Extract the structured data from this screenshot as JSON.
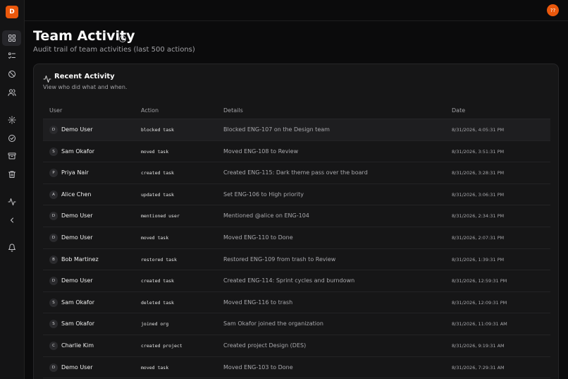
{
  "app": {
    "logo_letter": "D",
    "user_initials": "??"
  },
  "sidebar": {
    "items": [
      {
        "icon": "dashboard-icon",
        "active": true
      },
      {
        "icon": "list-checks-icon",
        "active": false
      },
      {
        "icon": "ban-icon",
        "active": false
      },
      {
        "icon": "users-icon",
        "active": false
      },
      {
        "icon": "gear-icon",
        "active": false
      },
      {
        "icon": "check-circle-icon",
        "active": false
      },
      {
        "icon": "archive-icon",
        "active": false
      },
      {
        "icon": "trash-icon",
        "active": false
      },
      {
        "icon": "activity-icon",
        "active": false
      },
      {
        "icon": "chevron-left-icon",
        "active": false
      },
      {
        "icon": "bell-icon",
        "active": false
      }
    ]
  },
  "page": {
    "title": "Team Activity",
    "subtitle": "Audit trail of team activities (last 500 actions)"
  },
  "card": {
    "title": "Recent Activity",
    "subtitle": "View who did what and when."
  },
  "table": {
    "headers": {
      "user": "User",
      "action": "Action",
      "details": "Details",
      "date": "Date"
    },
    "rows": [
      {
        "initial": "D",
        "user": "Demo User",
        "action": "blocked task",
        "details": "Blocked ENG-107 on the Design team",
        "date": "8/31/2026, 4:05:31 PM"
      },
      {
        "initial": "S",
        "user": "Sam Okafor",
        "action": "moved task",
        "details": "Moved ENG-108 to Review",
        "date": "8/31/2026, 3:51:31 PM"
      },
      {
        "initial": "P",
        "user": "Priya Nair",
        "action": "created task",
        "details": "Created ENG-115: Dark theme pass over the board",
        "date": "8/31/2026, 3:28:31 PM"
      },
      {
        "initial": "A",
        "user": "Alice Chen",
        "action": "updated task",
        "details": "Set ENG-106 to High priority",
        "date": "8/31/2026, 3:06:31 PM"
      },
      {
        "initial": "D",
        "user": "Demo User",
        "action": "mentioned user",
        "details": "Mentioned @alice on ENG-104",
        "date": "8/31/2026, 2:34:31 PM"
      },
      {
        "initial": "D",
        "user": "Demo User",
        "action": "moved task",
        "details": "Moved ENG-110 to Done",
        "date": "8/31/2026, 2:07:31 PM"
      },
      {
        "initial": "B",
        "user": "Bob Martinez",
        "action": "restored task",
        "details": "Restored ENG-109 from trash to Review",
        "date": "8/31/2026, 1:39:31 PM"
      },
      {
        "initial": "D",
        "user": "Demo User",
        "action": "created task",
        "details": "Created ENG-114: Sprint cycles and burndown",
        "date": "8/31/2026, 12:59:31 PM"
      },
      {
        "initial": "S",
        "user": "Sam Okafor",
        "action": "deleted task",
        "details": "Moved ENG-116 to trash",
        "date": "8/31/2026, 12:09:31 PM"
      },
      {
        "initial": "S",
        "user": "Sam Okafor",
        "action": "joined org",
        "details": "Sam Okafor joined the organization",
        "date": "8/31/2026, 11:09:31 AM"
      },
      {
        "initial": "C",
        "user": "Charlie Kim",
        "action": "created project",
        "details": "Created project Design (DES)",
        "date": "8/31/2026, 9:19:31 AM"
      },
      {
        "initial": "D",
        "user": "Demo User",
        "action": "moved task",
        "details": "Moved ENG-103 to Done",
        "date": "8/31/2026, 7:29:31 AM"
      }
    ]
  },
  "colors": {
    "accent": "#ea580c",
    "background": "#0b0b0c",
    "card": "#161617"
  }
}
